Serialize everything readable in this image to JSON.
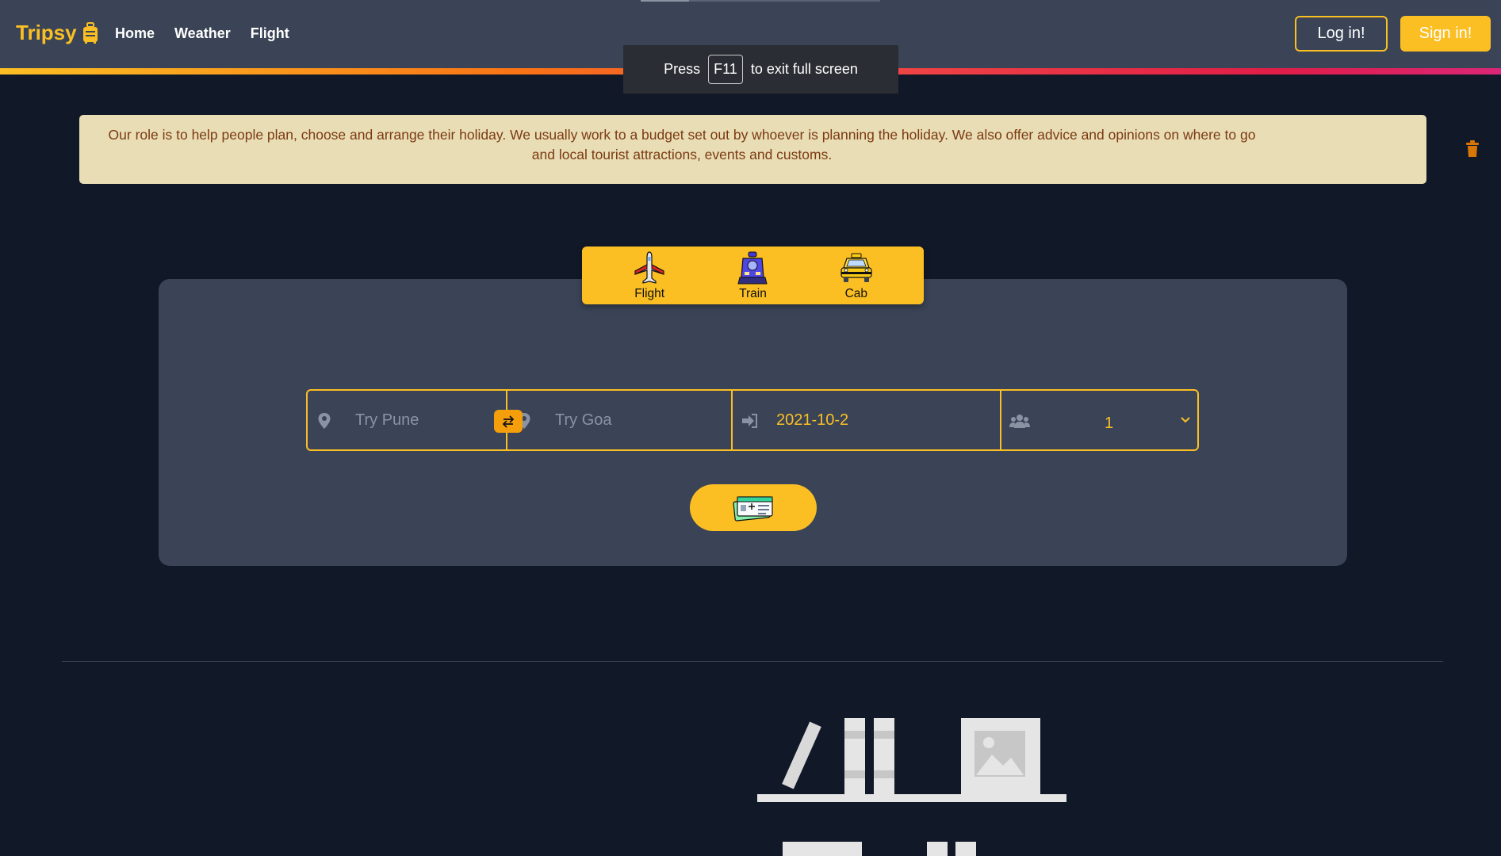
{
  "navbar": {
    "brand": "Tripsy",
    "brand_icon": "luggage-icon",
    "links": [
      "Home",
      "Weather",
      "Flight"
    ],
    "login_label": "Log in!",
    "signin_label": "Sign in!"
  },
  "fullscreen_toast": {
    "press": "Press",
    "key": "F11",
    "suffix": "to exit full screen"
  },
  "alert": {
    "text": "Our role is to help people plan, choose and arrange their holiday. We usually work to a budget set out by whoever is planning the holiday. We also offer advice and opinions on where to go and local tourist attractions, events and customs.",
    "dismiss_icon": "trash-icon"
  },
  "tabs": [
    {
      "label": "Flight",
      "icon": "airplane-icon"
    },
    {
      "label": "Train",
      "icon": "train-icon"
    },
    {
      "label": "Cab",
      "icon": "taxi-icon"
    }
  ],
  "search": {
    "from_placeholder": "Try Pune",
    "to_placeholder": "Try Goa",
    "date_value": "2021-10-2",
    "passengers_value": "1",
    "search_icon": "tickets-icon"
  },
  "colors": {
    "accent": "#fbbf24",
    "navbar_bg": "#3a4456",
    "page_bg": "#111827",
    "alert_bg": "#e8ddb5",
    "alert_text": "#7c3a12"
  }
}
